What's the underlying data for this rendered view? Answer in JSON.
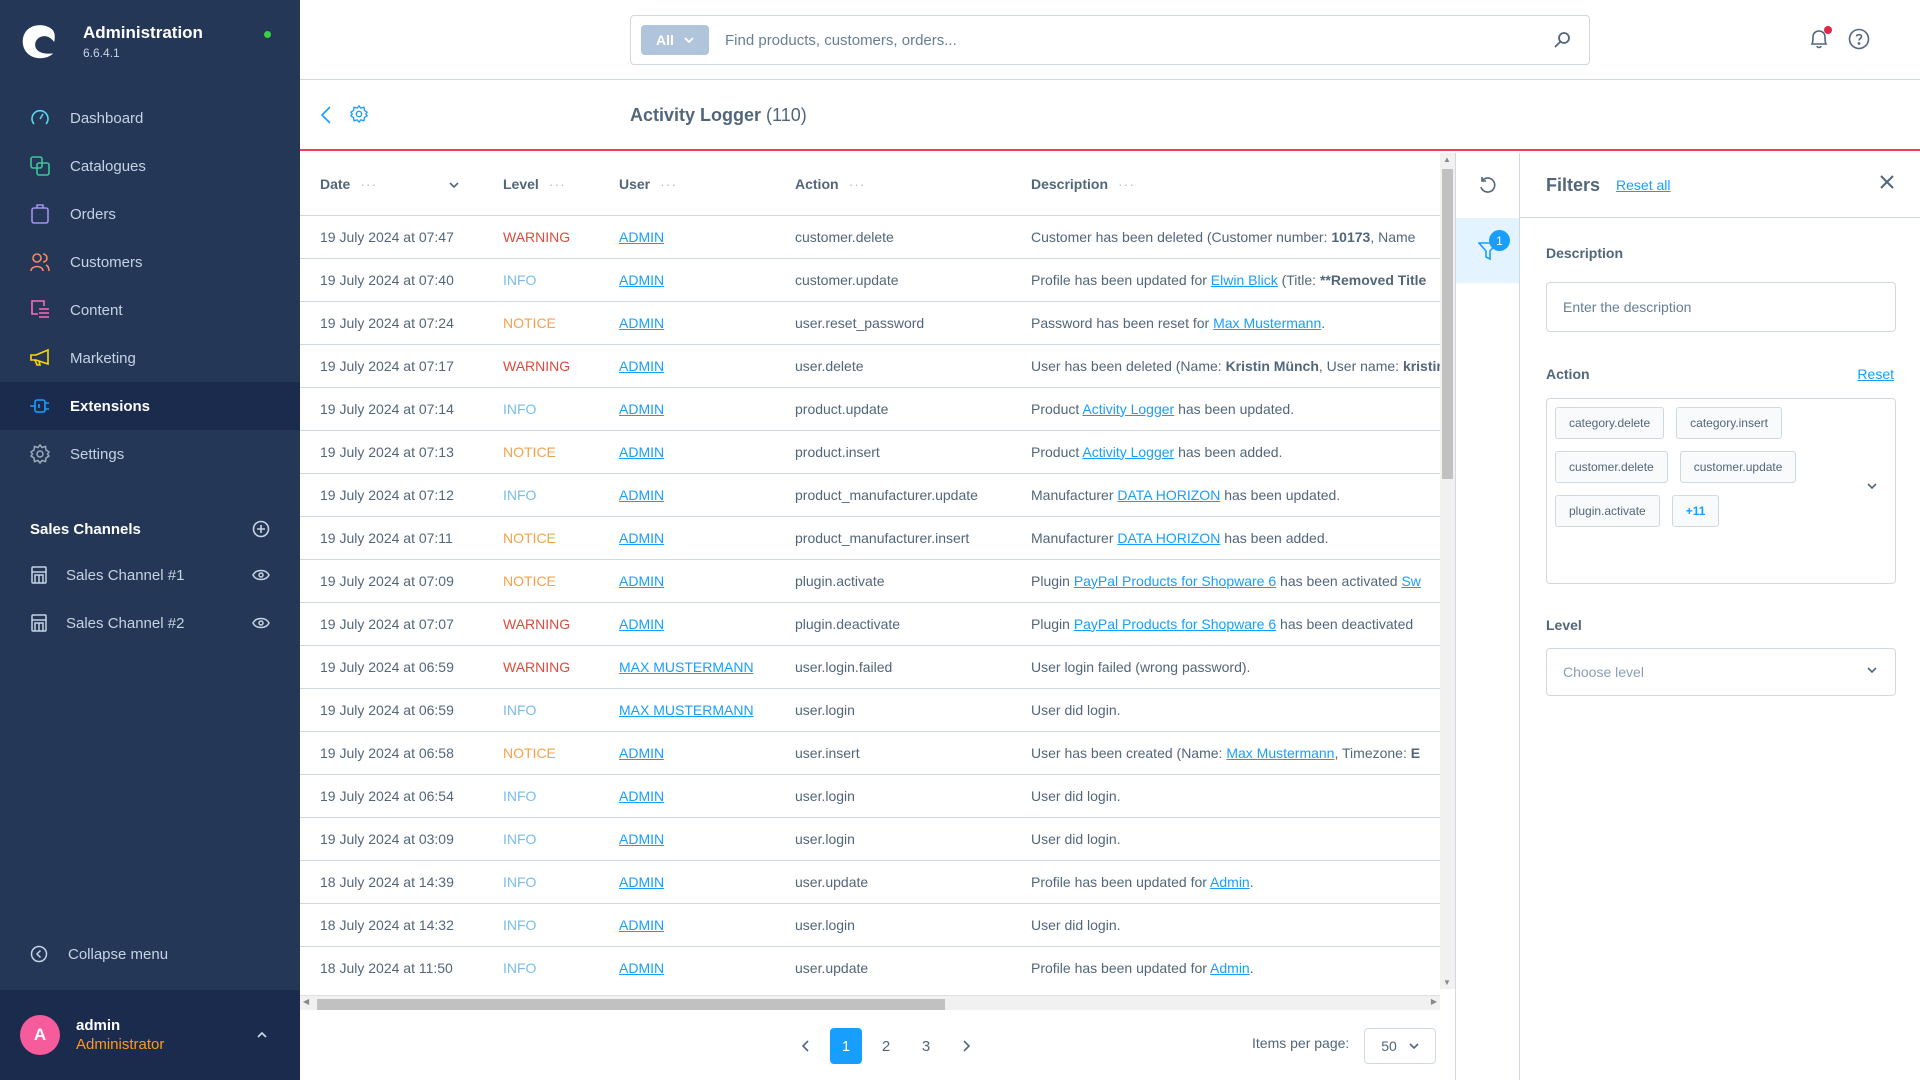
{
  "app": {
    "title": "Administration",
    "version": "6.6.4.1",
    "status_color": "#37d046"
  },
  "sidebar": {
    "items": [
      {
        "label": "Dashboard",
        "icon": "dashboard-icon",
        "color": "#57d9f0",
        "active": false
      },
      {
        "label": "Catalogues",
        "icon": "catalogues-icon",
        "color": "#3cc79a",
        "active": false
      },
      {
        "label": "Orders",
        "icon": "orders-icon",
        "color": "#a092f0",
        "active": false
      },
      {
        "label": "Customers",
        "icon": "customers-icon",
        "color": "#f88962",
        "active": false
      },
      {
        "label": "Content",
        "icon": "content-icon",
        "color": "#ff68b4",
        "active": false
      },
      {
        "label": "Marketing",
        "icon": "marketing-icon",
        "color": "#ffd700",
        "active": false
      },
      {
        "label": "Extensions",
        "icon": "extensions-icon",
        "color": "#189eff",
        "active": true
      },
      {
        "label": "Settings",
        "icon": "settings-icon",
        "color": "#9aa8b5",
        "active": false
      }
    ],
    "sales_channels_title": "Sales Channels",
    "sales_channels": [
      {
        "label": "Sales Channel #1"
      },
      {
        "label": "Sales Channel #2"
      }
    ],
    "collapse_label": "Collapse menu",
    "user": {
      "initial": "A",
      "name": "admin",
      "role": "Administrator"
    }
  },
  "header": {
    "search_type": "All",
    "search_placeholder": "Find products, customers, orders..."
  },
  "page": {
    "title": "Activity Logger",
    "count": "(110)"
  },
  "table": {
    "columns": {
      "date": "Date",
      "level": "Level",
      "user": "User",
      "action": "Action",
      "description": "Description"
    },
    "rows": [
      {
        "date": "19 July 2024 at 07:47",
        "level": "WARNING",
        "user": "ADMIN",
        "action": "customer.delete",
        "desc": [
          {
            "t": "Customer has been deleted (Customer number: "
          },
          {
            "t": "10173",
            "b": true
          },
          {
            "t": ", Name"
          }
        ]
      },
      {
        "date": "19 July 2024 at 07:40",
        "level": "INFO",
        "user": "ADMIN",
        "action": "customer.update",
        "desc": [
          {
            "t": "Profile has been updated for "
          },
          {
            "t": "Elwin Blick",
            "link": true
          },
          {
            "t": " (Title: "
          },
          {
            "t": "**Removed Title",
            "b": true
          }
        ]
      },
      {
        "date": "19 July 2024 at 07:24",
        "level": "NOTICE",
        "user": "ADMIN",
        "action": "user.reset_password",
        "desc": [
          {
            "t": "Password has been reset for "
          },
          {
            "t": "Max Mustermann",
            "link": true
          },
          {
            "t": "."
          }
        ]
      },
      {
        "date": "19 July 2024 at 07:17",
        "level": "WARNING",
        "user": "ADMIN",
        "action": "user.delete",
        "desc": [
          {
            "t": "User has been deleted (Name: "
          },
          {
            "t": "Kristin Münch",
            "b": true
          },
          {
            "t": ", User name: "
          },
          {
            "t": "kristin",
            "b": true
          }
        ]
      },
      {
        "date": "19 July 2024 at 07:14",
        "level": "INFO",
        "user": "ADMIN",
        "action": "product.update",
        "desc": [
          {
            "t": "Product "
          },
          {
            "t": "Activity Logger",
            "link": true
          },
          {
            "t": " has been updated."
          }
        ]
      },
      {
        "date": "19 July 2024 at 07:13",
        "level": "NOTICE",
        "user": "ADMIN",
        "action": "product.insert",
        "desc": [
          {
            "t": "Product "
          },
          {
            "t": "Activity Logger",
            "link": true
          },
          {
            "t": " has been added."
          }
        ]
      },
      {
        "date": "19 July 2024 at 07:12",
        "level": "INFO",
        "user": "ADMIN",
        "action": "product_manufacturer.update",
        "desc": [
          {
            "t": "Manufacturer "
          },
          {
            "t": "DATA HORIZON",
            "link": true
          },
          {
            "t": " has been updated."
          }
        ]
      },
      {
        "date": "19 July 2024 at 07:11",
        "level": "NOTICE",
        "user": "ADMIN",
        "action": "product_manufacturer.insert",
        "desc": [
          {
            "t": "Manufacturer "
          },
          {
            "t": "DATA HORIZON",
            "link": true
          },
          {
            "t": " has been added."
          }
        ]
      },
      {
        "date": "19 July 2024 at 07:09",
        "level": "NOTICE",
        "user": "ADMIN",
        "action": "plugin.activate",
        "desc": [
          {
            "t": "Plugin "
          },
          {
            "t": "PayPal Products for Shopware 6",
            "link": true
          },
          {
            "t": " has been activated "
          },
          {
            "t": "Sw",
            "link": true
          }
        ]
      },
      {
        "date": "19 July 2024 at 07:07",
        "level": "WARNING",
        "user": "ADMIN",
        "action": "plugin.deactivate",
        "desc": [
          {
            "t": "Plugin "
          },
          {
            "t": "PayPal Products for Shopware 6",
            "link": true
          },
          {
            "t": " has been deactivated "
          }
        ]
      },
      {
        "date": "19 July 2024 at 06:59",
        "level": "WARNING",
        "user": "MAX MUSTERMANN",
        "action": "user.login.failed",
        "desc": [
          {
            "t": "User login failed (wrong password)."
          }
        ]
      },
      {
        "date": "19 July 2024 at 06:59",
        "level": "INFO",
        "user": "MAX MUSTERMANN",
        "action": "user.login",
        "desc": [
          {
            "t": "User did login."
          }
        ]
      },
      {
        "date": "19 July 2024 at 06:58",
        "level": "NOTICE",
        "user": "ADMIN",
        "action": "user.insert",
        "desc": [
          {
            "t": "User has been created (Name: "
          },
          {
            "t": "Max Mustermann",
            "link": true
          },
          {
            "t": ", Timezone: "
          },
          {
            "t": "E",
            "b": true
          }
        ]
      },
      {
        "date": "19 July 2024 at 06:54",
        "level": "INFO",
        "user": "ADMIN",
        "action": "user.login",
        "desc": [
          {
            "t": "User did login."
          }
        ]
      },
      {
        "date": "19 July 2024 at 03:09",
        "level": "INFO",
        "user": "ADMIN",
        "action": "user.login",
        "desc": [
          {
            "t": "User did login."
          }
        ]
      },
      {
        "date": "18 July 2024 at 14:39",
        "level": "INFO",
        "user": "ADMIN",
        "action": "user.update",
        "desc": [
          {
            "t": "Profile has been updated for "
          },
          {
            "t": "Admin",
            "link": true
          },
          {
            "t": "."
          }
        ]
      },
      {
        "date": "18 July 2024 at 14:32",
        "level": "INFO",
        "user": "ADMIN",
        "action": "user.login",
        "desc": [
          {
            "t": "User did login."
          }
        ]
      },
      {
        "date": "18 July 2024 at 11:50",
        "level": "INFO",
        "user": "ADMIN",
        "action": "user.update",
        "desc": [
          {
            "t": "Profile has been updated for "
          },
          {
            "t": "Admin",
            "link": true
          },
          {
            "t": "."
          }
        ]
      }
    ]
  },
  "pagination": {
    "pages": [
      "1",
      "2",
      "3"
    ],
    "current": "1",
    "items_per_page_label": "Items per page:",
    "items_per_page": "50"
  },
  "filters": {
    "title": "Filters",
    "reset_all": "Reset all",
    "active_count": "1",
    "description": {
      "label": "Description",
      "placeholder": "Enter the description"
    },
    "action": {
      "label": "Action",
      "reset": "Reset",
      "selected": [
        "category.delete",
        "category.insert",
        "customer.delete",
        "customer.update",
        "plugin.activate"
      ],
      "more": "+11"
    },
    "level": {
      "label": "Level",
      "placeholder": "Choose level"
    }
  },
  "colors": {
    "accent": "#189eff",
    "warning": "#de4b3c",
    "info": "#79bde8",
    "notice": "#f4a14b",
    "title_underline": "#f43b5b",
    "sidebar_bg": "#243757"
  }
}
